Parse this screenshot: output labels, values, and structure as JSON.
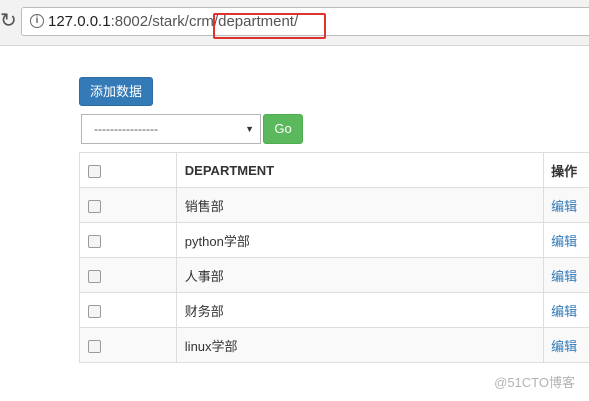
{
  "browser": {
    "reload_icon": "reload-icon",
    "info_icon": "info-icon",
    "url_host": "127.0.0.1",
    "url_rest": ":8002/stark/crm/department/"
  },
  "toolbar": {
    "add_label": "添加数据"
  },
  "filter": {
    "selected": "----------------",
    "go_label": "Go"
  },
  "table": {
    "headers": [
      "",
      "DEPARTMENT",
      "操作"
    ],
    "rows": [
      {
        "name": "销售部",
        "action": "编辑"
      },
      {
        "name": "python学部",
        "action": "编辑"
      },
      {
        "name": "人事部",
        "action": "编辑"
      },
      {
        "name": "财务部",
        "action": "编辑"
      },
      {
        "name": "linux学部",
        "action": "编辑"
      }
    ]
  },
  "watermark": "@51CTO博客",
  "colors": {
    "primary": "#337ab7",
    "success": "#5cb85c",
    "highlight_box": "#e0322c"
  }
}
